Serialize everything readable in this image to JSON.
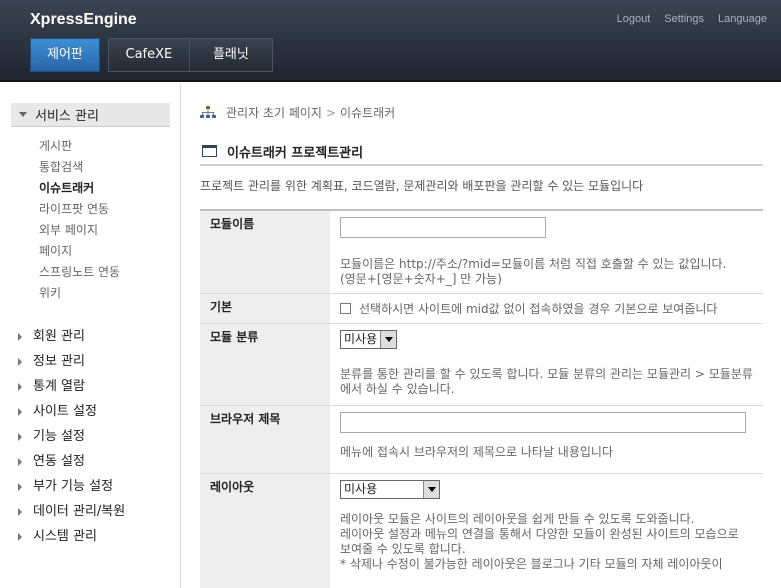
{
  "header": {
    "logo": "XpressEngine",
    "links": [
      "Logout",
      "Settings",
      "Language"
    ],
    "tabs": [
      "제어판",
      "CafeXE",
      "플래닛"
    ]
  },
  "sidebar": {
    "section": "서비스 관리",
    "subitems": [
      "게시판",
      "통합검색",
      "이슈트래커",
      "라이프팟 연동",
      "외부 페이지",
      "페이지",
      "스프링노트 연동",
      "위키"
    ],
    "current": "이슈트래커",
    "menus": [
      "회원 관리",
      "정보 관리",
      "통계 열람",
      "사이트 설정",
      "기능 설정",
      "연동 설정",
      "부가 기능 설정",
      "데이터 관리/복원",
      "시스템 관리"
    ]
  },
  "content": {
    "breadcrumb": [
      "관리자 초기 페이지",
      "이슈트래커"
    ],
    "breadcrumb_sep": ">",
    "title": "이슈트래커 프로젝트관리",
    "description": "프로젝트 관리를 위한 계획표, 코드열람, 문제관리와 배포판을 관리할 수 있는 모듈입니다",
    "fields": {
      "module_name": {
        "label": "모듈이름",
        "value": "",
        "help1": "모듈이름은 http://주소/?mid=모듈이름 처럼 직접 호출할 수 있는 값입니다.",
        "help2": "(영문+[영문+숫자+_] 만 가능)"
      },
      "default": {
        "label": "기본",
        "text": "선택하시면 사이트에 mid값 없이 접속하였을 경우 기본으로 보여줍니다"
      },
      "category": {
        "label": "모듈 분류",
        "selected": "미사용",
        "help": "분류를 통한 관리를 할 수 있도록 합니다. 모듈 분류의 관리는 모듈관리 > 모듈분류 에서 하실 수 있습니다."
      },
      "browser_title": {
        "label": "브라우저 제목",
        "value": "",
        "help": "메뉴에 접속시 브라우저의 제목으로 나타날 내용입니다"
      },
      "layout": {
        "label": "레이아웃",
        "selected": "미사용",
        "help1": "레이아웃 모듈은 사이트의 레이아웃을 쉽게 만들 수 있도록 도와줍니다.",
        "help2": "레이아웃 설정과 메뉴의 연결을 통해서 다양한 모듈이 완성된 사이트의 모습으로 보여줄 수 있도록 합니다.",
        "help3": "* 삭제나 수정이 불가능한 레이아웃은 블로그나 기타 모듈의 자체 레이아웃이"
      }
    }
  }
}
